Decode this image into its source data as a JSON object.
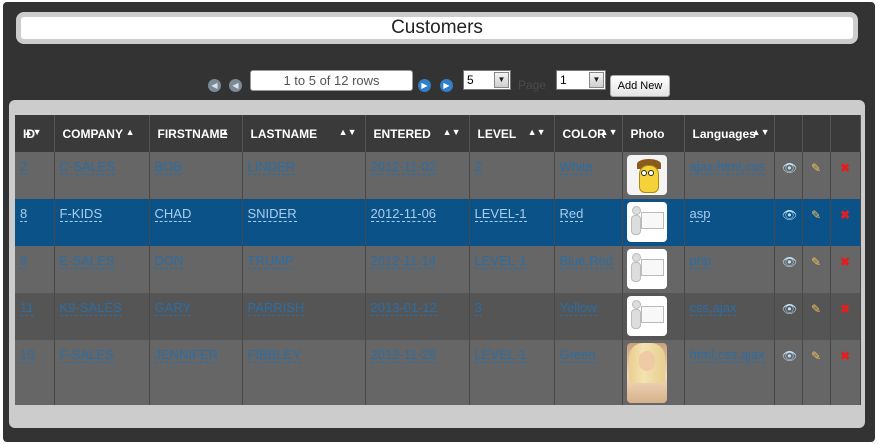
{
  "title": "Customers",
  "pager": {
    "rows_info": "1 to 5 of 12 rows",
    "page_size": "5",
    "page_label": "Page",
    "page_number": "1",
    "add_new_label": "Add New",
    "first_icon": "first-page-icon",
    "prev_icon": "prev-page-icon",
    "next_icon": "next-page-icon",
    "last_icon": "last-page-icon"
  },
  "table": {
    "headers": {
      "id": "ID",
      "company": "COMPANY",
      "firstname": "FIRSTNAME",
      "lastname": "LASTNAME",
      "entered": "ENTERED",
      "level": "LEVEL",
      "color": "COLOR",
      "photo": "Photo",
      "languages": "Languages"
    },
    "rows": [
      {
        "id": "2",
        "company": "C-SALES",
        "firstname": "BOB",
        "lastname": "LINDER",
        "entered": "2012-11-02",
        "level": "2",
        "color": "White",
        "photo": "cartoon",
        "languages": "ajax,html,css"
      },
      {
        "id": "8",
        "company": "F-KIDS",
        "firstname": "CHAD",
        "lastname": "SNIDER",
        "entered": "2012-11-06",
        "level": "LEVEL-1",
        "color": "Red",
        "photo": "placeholder",
        "languages": "asp"
      },
      {
        "id": "6",
        "company": "E-SALES",
        "firstname": "DON",
        "lastname": "TRUMP",
        "entered": "2012-11-14",
        "level": "LEVEL-1",
        "color": "Blue,Red",
        "photo": "placeholder",
        "languages": "php"
      },
      {
        "id": "11",
        "company": "K9-SALES",
        "firstname": "GARY",
        "lastname": "PARRISH",
        "entered": "2013-01-12",
        "level": "3",
        "color": "Yellow",
        "photo": "placeholder",
        "languages": "css,ajax"
      },
      {
        "id": "10",
        "company": "F-SALES",
        "firstname": "JENNIFER",
        "lastname": "FIBBLEY",
        "entered": "2012-11-28",
        "level": "LEVEL-1",
        "color": "Green",
        "photo": "photo",
        "languages": "html,css,ajax"
      }
    ],
    "selected_row_index": 1,
    "action_icons": [
      "view-icon",
      "edit-icon",
      "delete-icon"
    ]
  },
  "colors": {
    "frame": "#333333",
    "row_odd": "#666666",
    "row_even": "#555555",
    "row_selected": "#0b5288",
    "link": "#2a6ea6",
    "delete": "#e02020"
  }
}
